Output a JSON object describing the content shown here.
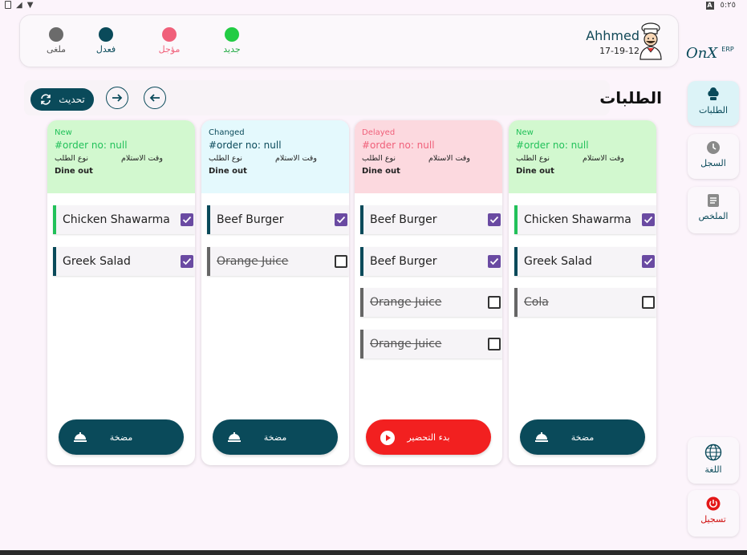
{
  "status_bar": {
    "time": "٥:٢٥"
  },
  "header": {
    "legend": [
      {
        "label": "ملغى",
        "color": "#6b6b6b"
      },
      {
        "label": "فعدل",
        "color": "#0a4a5a"
      },
      {
        "label": "مؤجل",
        "color": "#f0607a"
      },
      {
        "label": "جديد",
        "color": "#22cc44"
      }
    ],
    "user_name": "Ahhmed",
    "date": "17-19-12"
  },
  "logo": {
    "brand": "OnX",
    "suffix": "ERP"
  },
  "toolbar": {
    "refresh_label": "تحديث",
    "title": "الطلبات"
  },
  "orders": [
    {
      "status": "New",
      "status_color": "#22c15a",
      "head_bg": "#d2f8cf",
      "order_no": "#order no: null",
      "pickup_label": "وقت الاستلام",
      "type_label": "نوع الطلب",
      "dine": "Dine out",
      "items": [
        {
          "name": "Chicken Shawarma",
          "checked": true,
          "bar": "green"
        },
        {
          "name": "Greek Salad",
          "checked": true,
          "bar": "dark"
        }
      ],
      "button": {
        "label": "مضخة",
        "color": "dark"
      }
    },
    {
      "status": "Changed",
      "status_color": "#0a4a5a",
      "head_bg": "#e4f9fd",
      "order_no": "#order no: null",
      "pickup_label": "وقت الاستلام",
      "type_label": "نوع الطلب",
      "dine": "Dine out",
      "items": [
        {
          "name": "Beef Burger",
          "checked": true,
          "bar": "dark"
        },
        {
          "name": "Orange Juice",
          "checked": false,
          "bar": "grey"
        }
      ],
      "button": {
        "label": "مضخة",
        "color": "dark"
      }
    },
    {
      "status": "Delayed",
      "status_color": "#f0607a",
      "head_bg": "#fcd9df",
      "order_no": "#order no: null",
      "pickup_label": "وقت الاستلام",
      "type_label": "نوع الطلب",
      "dine": "Dine out",
      "items": [
        {
          "name": "Beef Burger",
          "checked": true,
          "bar": "dark"
        },
        {
          "name": "Beef Burger",
          "checked": true,
          "bar": "dark"
        },
        {
          "name": "Orange Juice",
          "checked": false,
          "bar": "grey"
        },
        {
          "name": "Orange Juice",
          "checked": false,
          "bar": "grey"
        }
      ],
      "button": {
        "label": "بدء التحضير",
        "color": "red"
      }
    },
    {
      "status": "New",
      "status_color": "#22c15a",
      "head_bg": "#d2f8cf",
      "order_no": "#order no: null",
      "pickup_label": "وقت الاستلام",
      "type_label": "نوع الطلب",
      "dine": "Dine out",
      "items": [
        {
          "name": "Chicken Shawarma",
          "checked": true,
          "bar": "green"
        },
        {
          "name": "Greek Salad",
          "checked": true,
          "bar": "dark"
        },
        {
          "name": "Cola",
          "checked": false,
          "bar": "grey"
        }
      ],
      "button": {
        "label": "مضخة",
        "color": "dark"
      }
    }
  ],
  "sidebar": {
    "orders_label": "الطلبات",
    "history_label": "السجل",
    "summary_label": "الملخص",
    "language_label": "اللغة",
    "logout_label": "تسجيل"
  }
}
